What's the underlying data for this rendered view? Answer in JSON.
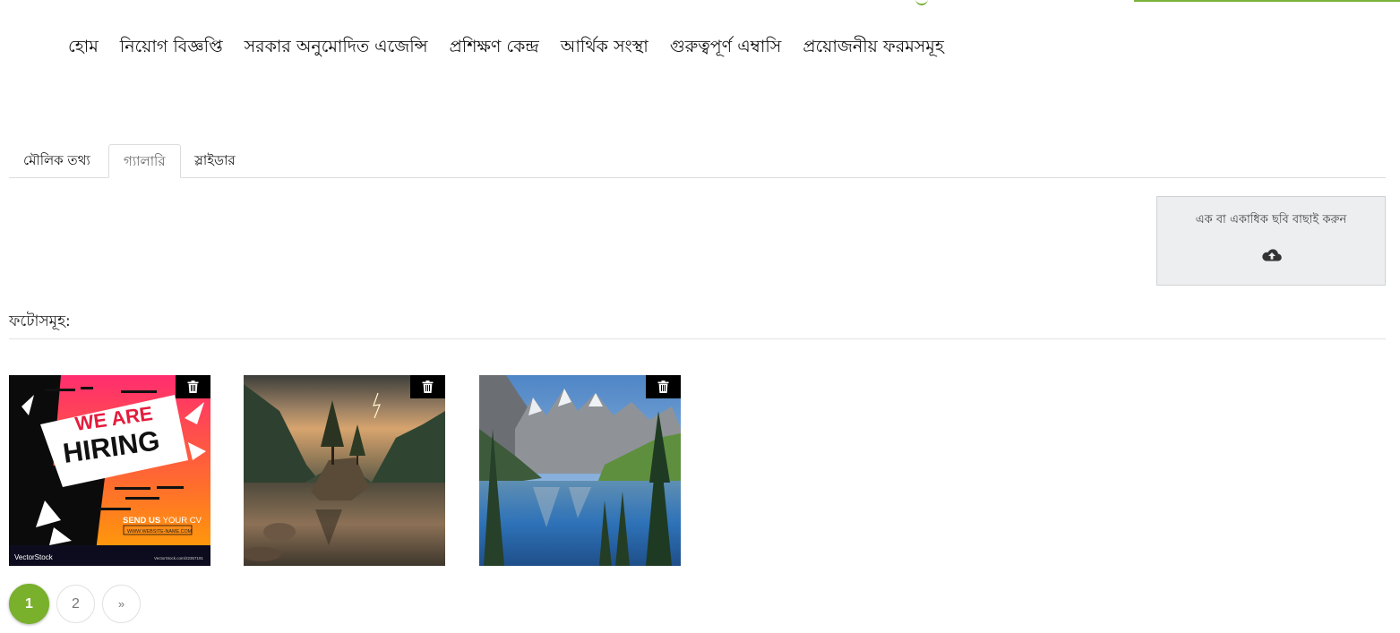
{
  "nav": {
    "items": [
      {
        "label": "হোম"
      },
      {
        "label": "নিয়োগ বিজ্ঞপ্তি"
      },
      {
        "label": "সরকার অনুমোদিত এজেন্সি"
      },
      {
        "label": "প্রশিক্ষণ কেন্দ্র"
      },
      {
        "label": "আর্থিক সংস্থা"
      },
      {
        "label": "গুরুত্বপূর্ণ এম্বাসি"
      },
      {
        "label": "প্রয়োজনীয় ফরমসমূহ"
      }
    ]
  },
  "tabs": {
    "basic": "মৌলিক তথ্য",
    "gallery": "গ্যালারি",
    "slider": "স্লাইডার",
    "active": "gallery"
  },
  "upload": {
    "label": "এক বা একাধিক ছবি বাছাই করুন",
    "icon": "cloud-upload-icon"
  },
  "photos": {
    "label": "ফটোসমূহ:",
    "items": [
      {
        "name": "we-are-hiring",
        "text_line1": "WE ARE",
        "text_line2": "HIRING",
        "cta_a": "SEND US",
        "cta_b": " YOUR CV",
        "website": "WWW.WEBSITE-NAME.COM",
        "watermark": "VectorStock",
        "watermark_id": "VectorStock.com/22357191"
      },
      {
        "name": "lake-island-lightning"
      },
      {
        "name": "mountain-lake-reflection"
      }
    ],
    "delete_icon": "trash-icon"
  },
  "pagination": {
    "pages": [
      "1",
      "2"
    ],
    "current": "1",
    "next": "»"
  },
  "colors": {
    "accent": "#79b02c",
    "upload_bg": "#eceeef",
    "delete_bg": "#000000"
  }
}
